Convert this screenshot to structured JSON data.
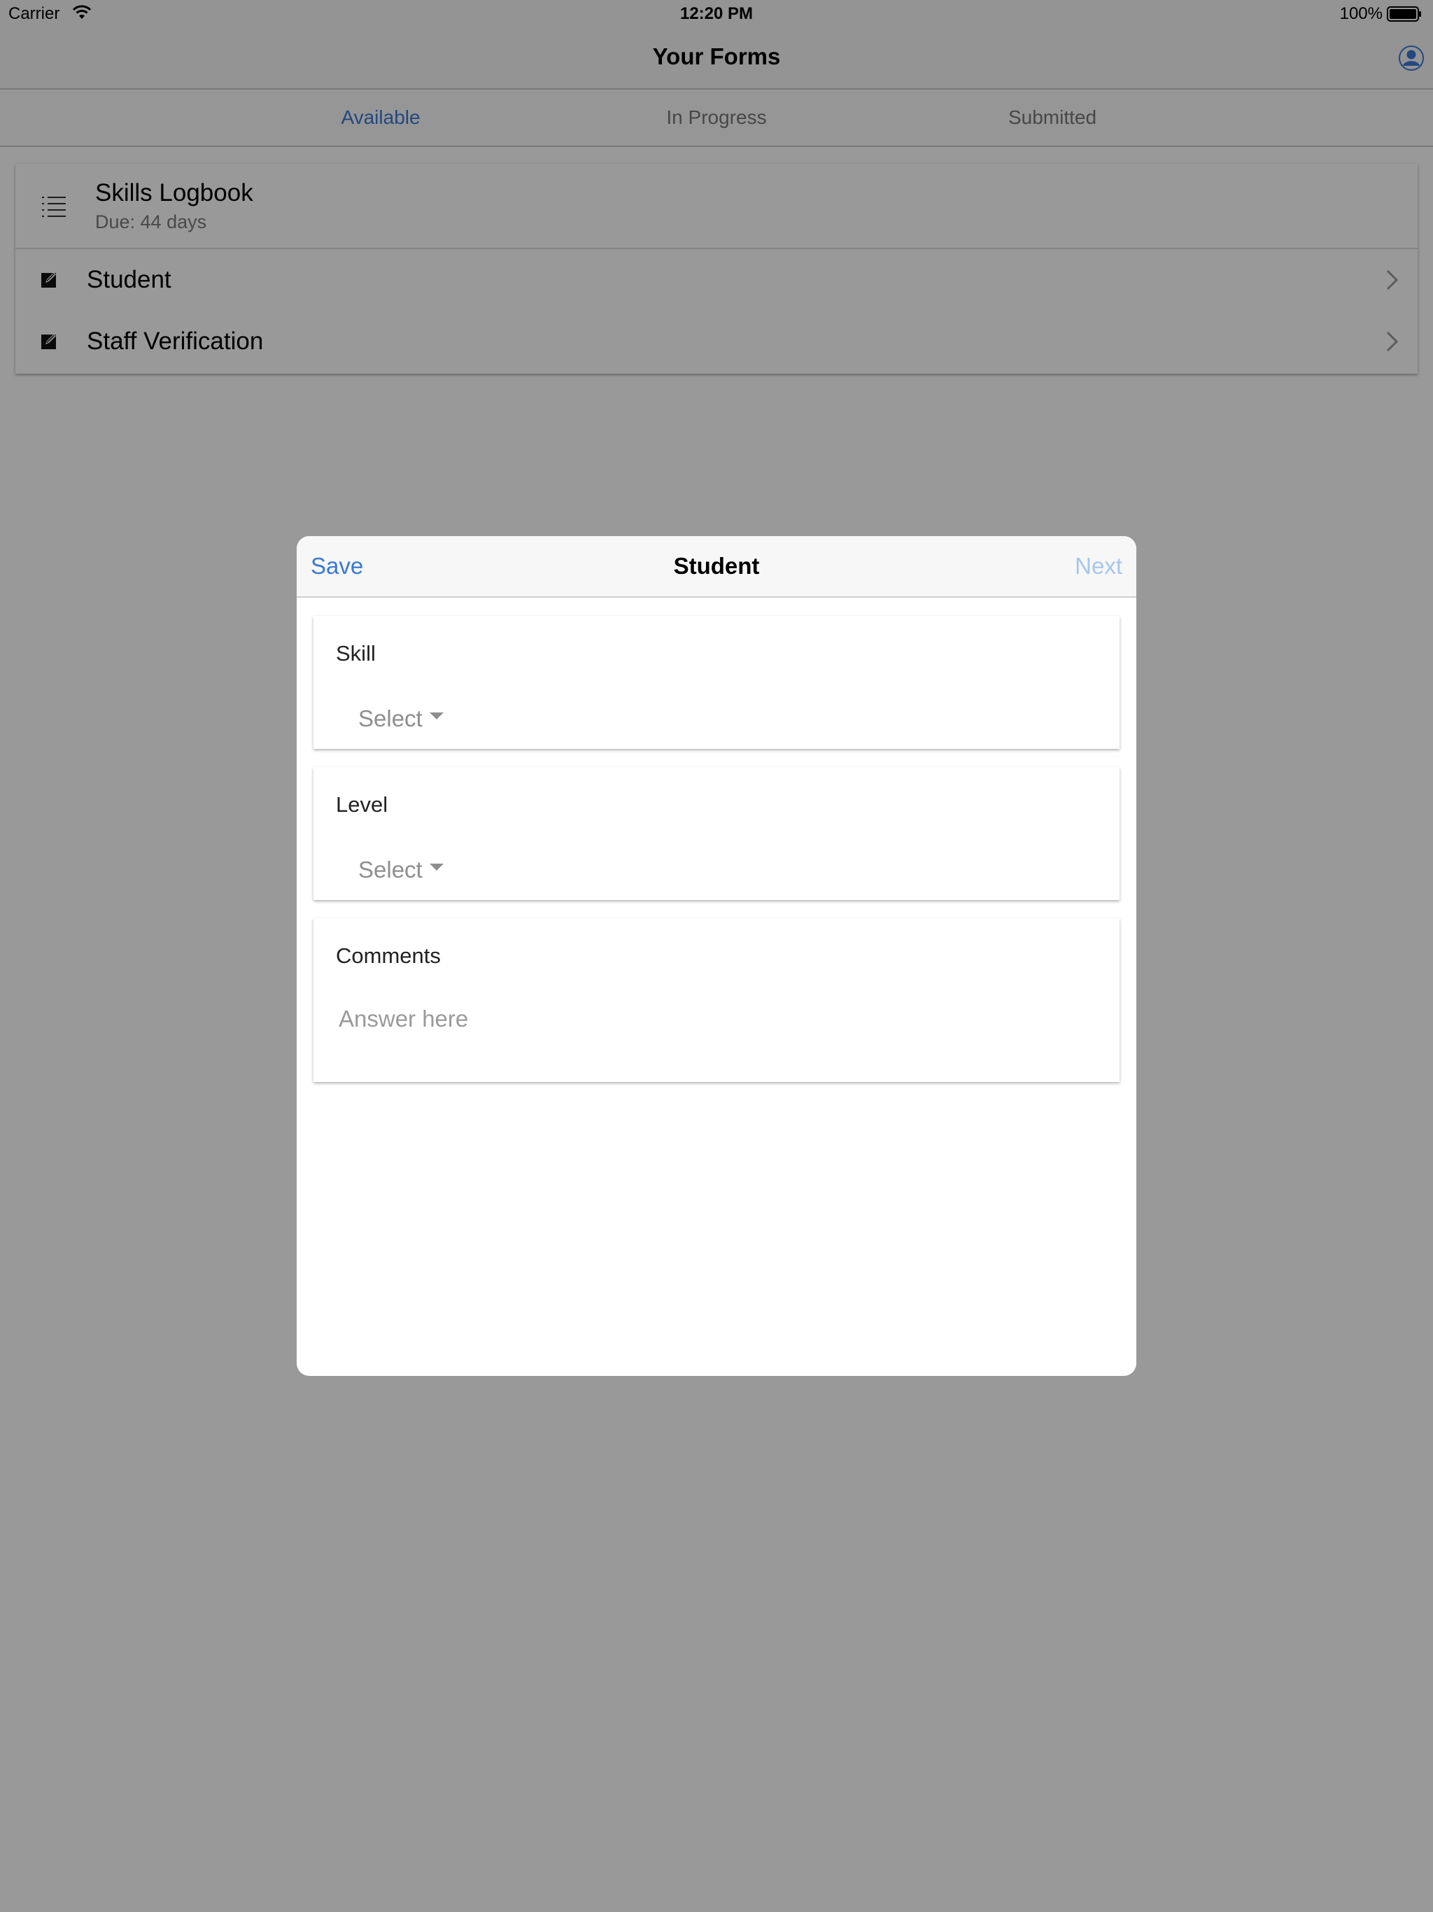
{
  "status_bar": {
    "carrier": "Carrier",
    "time": "12:20 PM",
    "battery": "100%"
  },
  "nav": {
    "title": "Your Forms",
    "profile_icon": "person-circle-icon"
  },
  "tabs": [
    {
      "label": "Available",
      "active": true
    },
    {
      "label": "In Progress",
      "active": false
    },
    {
      "label": "Submitted",
      "active": false
    }
  ],
  "form": {
    "title": "Skills Logbook",
    "due": "Due: 44 days",
    "items": [
      {
        "label": "Student"
      },
      {
        "label": "Staff Verification"
      }
    ]
  },
  "modal": {
    "save_label": "Save",
    "title": "Student",
    "next_label": "Next",
    "fields": [
      {
        "label": "Skill",
        "value": "Select"
      },
      {
        "label": "Level",
        "value": "Select"
      },
      {
        "label": "Comments",
        "placeholder": "Answer here"
      }
    ]
  },
  "colors": {
    "accent": "#3a78d4",
    "accent_disabled": "#a8c5ec",
    "overlay": "rgba(0,0,0,0.4)"
  }
}
